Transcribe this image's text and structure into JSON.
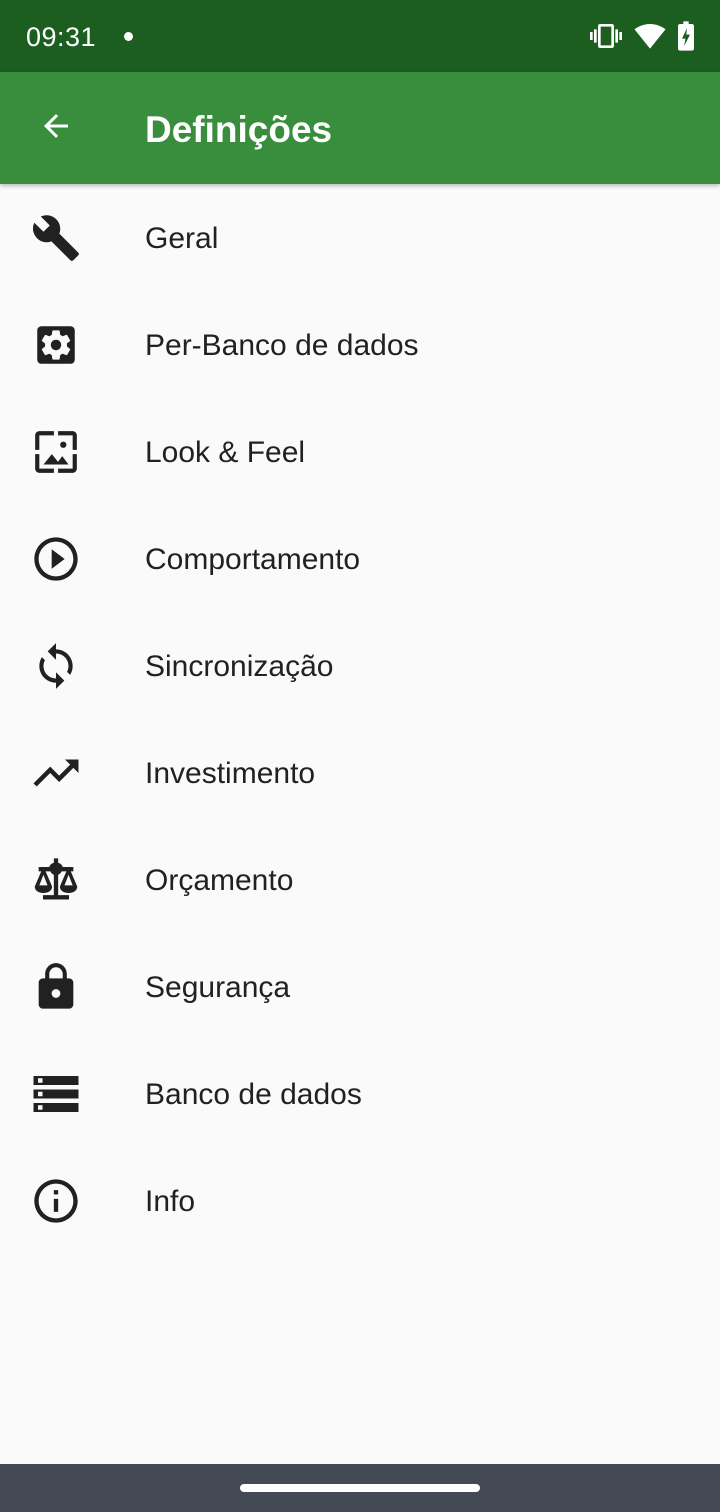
{
  "status_bar": {
    "time": "09:31"
  },
  "app_bar": {
    "title": "Definições"
  },
  "settings": [
    {
      "label": "Geral",
      "icon": "wrench-icon"
    },
    {
      "label": "Per-Banco de dados",
      "icon": "gear-icon"
    },
    {
      "label": "Look & Feel",
      "icon": "wallpaper-icon"
    },
    {
      "label": "Comportamento",
      "icon": "play-circle-icon"
    },
    {
      "label": "Sincronização",
      "icon": "sync-icon"
    },
    {
      "label": "Investimento",
      "icon": "trending-up-icon"
    },
    {
      "label": "Orçamento",
      "icon": "balance-scale-icon"
    },
    {
      "label": "Segurança",
      "icon": "lock-icon"
    },
    {
      "label": "Banco de dados",
      "icon": "storage-icon"
    },
    {
      "label": "Info",
      "icon": "info-icon"
    }
  ],
  "colors": {
    "status_bar": "#1b5e20",
    "app_bar": "#388e3c",
    "background": "#fafafa",
    "text": "#212121",
    "icon": "#212121",
    "nav_bar": "#434a54"
  }
}
